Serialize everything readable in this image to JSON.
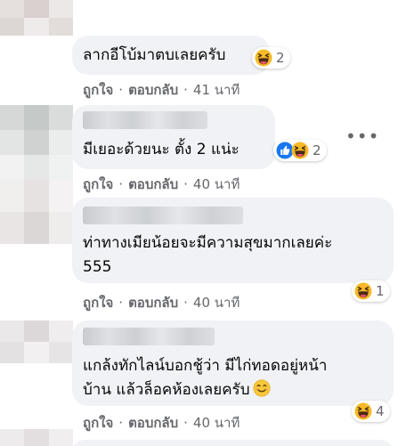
{
  "comments": [
    {
      "text_lines": [
        "ลากอีโบ้มาตบเลยครับ"
      ],
      "reactions": {
        "icons": [
          "haha-icon"
        ],
        "count": "2"
      },
      "actions": {
        "like": "ถูกใจ",
        "reply": "ตอบกลับ",
        "time": "41 นาที"
      }
    },
    {
      "text_lines": [
        "มีเยอะด้วยนะ ตั้ง 2 แน่ะ"
      ],
      "reactions": {
        "icons": [
          "like-icon",
          "haha-icon"
        ],
        "count": "2"
      },
      "actions": {
        "like": "ถูกใจ",
        "reply": "ตอบกลับ",
        "time": "40 นาที"
      },
      "more_label": "•••"
    },
    {
      "text_lines": [
        "ท่าทางเมียน้อยจะมีความสุขมากเลยค่ะ",
        "555"
      ],
      "reactions": {
        "icons": [
          "haha-icon"
        ],
        "count": "1"
      },
      "actions": {
        "like": "ถูกใจ",
        "reply": "ตอบกลับ",
        "time": "40 นาที"
      }
    },
    {
      "text_lines": [
        "แกล้งทักไลน์บอกชู้ว่า มีไก่ทอดอยู่หน้า",
        "บ้าน แล้วล็อคห้องเลยครับ"
      ],
      "inline_emoji": "smiling-face-icon",
      "reactions": {
        "icons": [
          "haha-icon"
        ],
        "count": "4"
      },
      "actions": {
        "like": "ถูกใจ",
        "reply": "ตอบกลับ",
        "time": "40 นาที"
      }
    }
  ],
  "separator": "·",
  "colors": {
    "bubble": "#f0f2f5",
    "meta_text": "#65676b",
    "body_text": "#050505",
    "like_blue": "#1877f2",
    "haha_yellow": "#f7b125"
  }
}
